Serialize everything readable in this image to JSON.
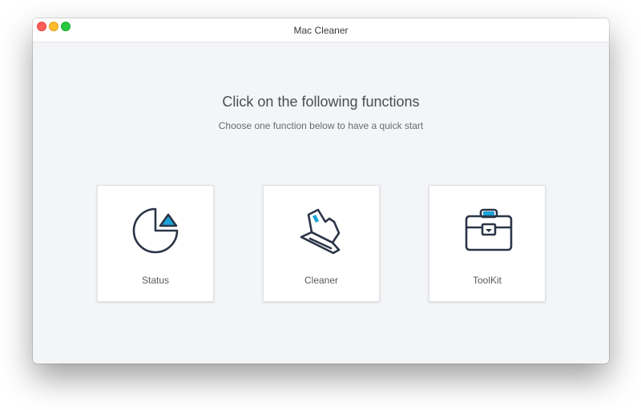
{
  "window": {
    "title": "Mac Cleaner"
  },
  "main": {
    "heading": "Click on the following functions",
    "subheading": "Choose one function below to have a quick start"
  },
  "functions": [
    {
      "label": "Status",
      "icon": "pie-chart-icon"
    },
    {
      "label": "Cleaner",
      "icon": "brush-icon"
    },
    {
      "label": "ToolKit",
      "icon": "toolbox-icon"
    }
  ],
  "colors": {
    "icon_stroke": "#2b3548",
    "accent": "#1aa3d9",
    "background": "#f4f5f7"
  }
}
